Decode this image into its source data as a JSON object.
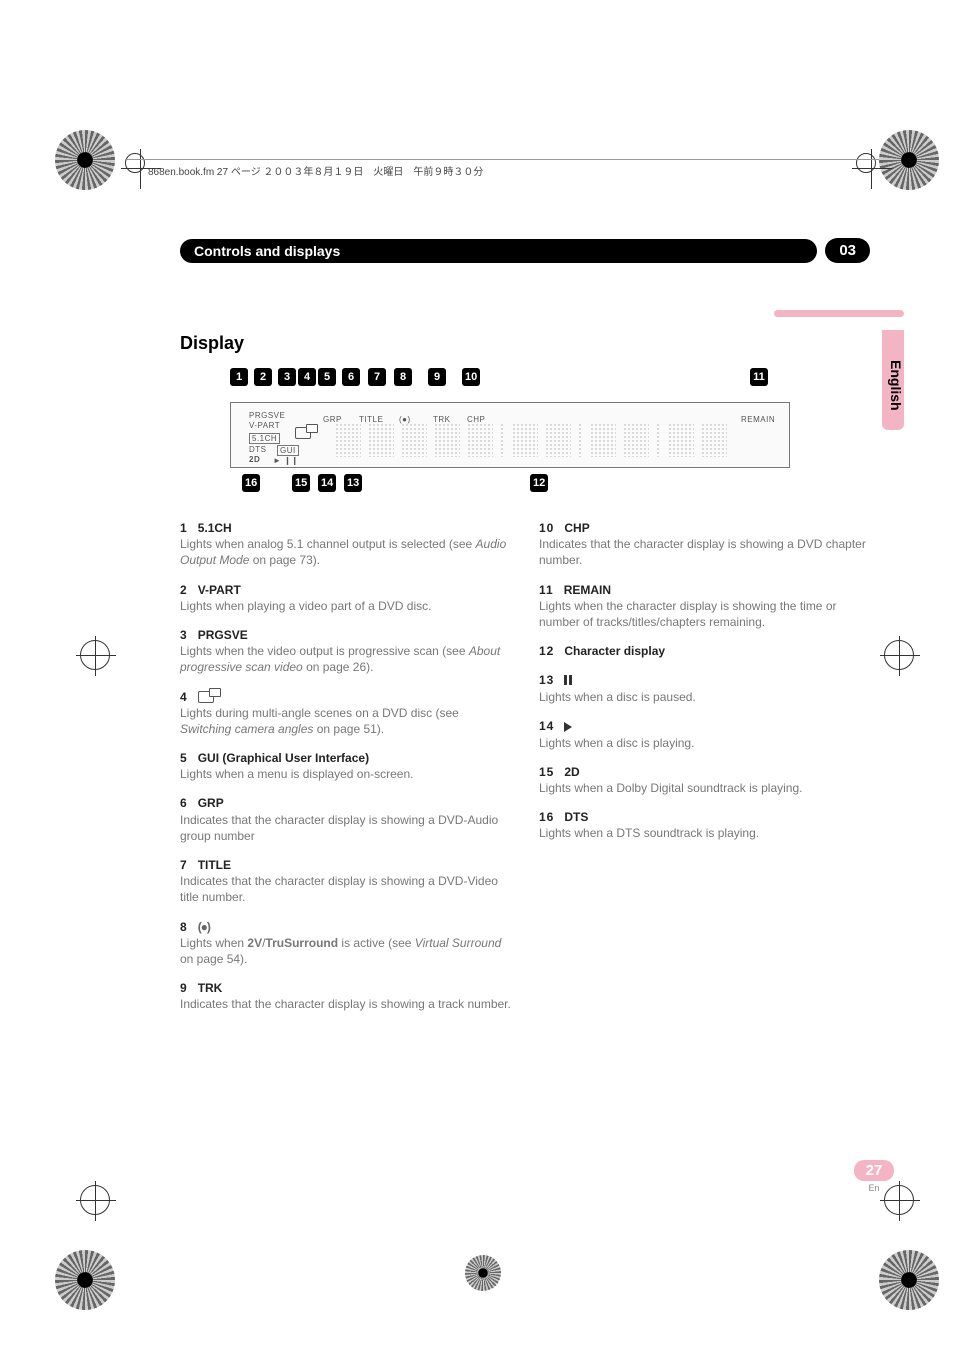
{
  "header_line": "868en.book.fm 27 ページ ２００３年８月１９日　火曜日　午前９時３０分",
  "chapter": {
    "title": "Controls and displays",
    "number": "03"
  },
  "section_title": "Display",
  "lcd_labels": {
    "prgsve": "PRGSVE",
    "vpart": "V-PART",
    "grp": "GRP",
    "title": "TITLE",
    "trk": "TRK",
    "chp": "CHP",
    "remain": "REMAIN",
    "fivech": "5.1CH",
    "dts": "DTS",
    "gui": "GUI",
    "dd": "D",
    "ddd": "2D"
  },
  "callouts_top": [
    "1",
    "2",
    "3",
    "4",
    "5",
    "6",
    "7",
    "8",
    "9",
    "10",
    "11"
  ],
  "callouts_bottom": [
    "16",
    "15",
    "14",
    "13",
    "12"
  ],
  "left_col": [
    {
      "num": "1",
      "label": "5.1CH",
      "desc": "Lights when analog 5.1 channel output is selected (see <i>Audio Output Mode</i> on page 73)."
    },
    {
      "num": "2",
      "label": "V-PART",
      "desc": "Lights when playing a video part of a DVD disc."
    },
    {
      "num": "3",
      "label": "PRGSVE",
      "desc": "Lights when the video output is progressive scan (see <i>About progressive scan video</i> on page 26)."
    },
    {
      "num": "4",
      "label": "__ANGLE__",
      "desc": "Lights during multi-angle scenes on a DVD disc (see <i>Switching camera angles</i> on page 51)."
    },
    {
      "num": "5",
      "label": "GUI (Graphical User Interface)",
      "desc": "Lights when a menu is displayed on-screen."
    },
    {
      "num": "6",
      "label": "GRP",
      "desc": "Indicates that the character display is showing a DVD-Audio group number"
    },
    {
      "num": "7",
      "label": "TITLE",
      "desc": "Indicates that the character display is showing a DVD-Video title number."
    },
    {
      "num": "8",
      "label": "__VIRT__",
      "desc": "Lights when <b>2V</b>/<b>TruSurround</b> is active (see <i>Virtual Surround</i> on page 54)."
    },
    {
      "num": "9",
      "label": "TRK",
      "desc": "Indicates that the character display is showing a track number."
    }
  ],
  "right_col": [
    {
      "num": "10",
      "label": "CHP",
      "desc": "Indicates that the character display is showing a DVD chapter number."
    },
    {
      "num": "11",
      "label": "REMAIN",
      "desc": "Lights when the character display is showing the time or number of tracks/titles/chapters remaining."
    },
    {
      "num": "12",
      "label": "Character display",
      "desc": ""
    },
    {
      "num": "13",
      "label": "__PAUSE__",
      "desc": "Lights when a disc is paused."
    },
    {
      "num": "14",
      "label": "__PLAY__",
      "desc": "Lights when a disc is playing."
    },
    {
      "num": "15",
      "label": "2D",
      "desc": "Lights when a Dolby Digital soundtrack is playing."
    },
    {
      "num": "16",
      "label": "DTS",
      "desc": "Lights when a DTS soundtrack is playing."
    }
  ],
  "lang_tab": "English",
  "page": {
    "number": "27",
    "lang": "En"
  }
}
